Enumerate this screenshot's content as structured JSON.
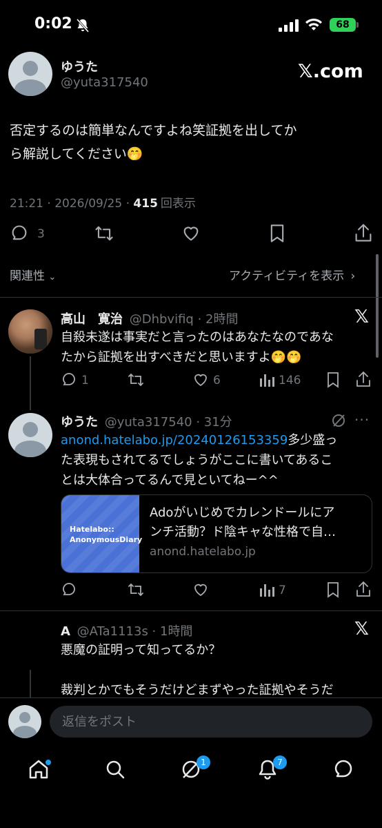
{
  "status_bar": {
    "time": "0:02",
    "battery": "68"
  },
  "main_tweet": {
    "display_name": "ゆうた",
    "handle": "@yuta317540",
    "brand": "𝕏.com",
    "text_line1": "否定するのは簡単なんですよね笑証拠を出してか",
    "text_line2": "ら解説してください🤭",
    "timestamp": "21:21 · 2026/09/25 · ",
    "views_count": "415",
    "views_label": "回表示",
    "reply_count": "3"
  },
  "filters": {
    "sort_label": "関連性",
    "activity_label": "アクティビティを表示"
  },
  "replies": [
    {
      "display_name": "高山　寛治",
      "handle": "@Dhbvifiq · 2時間",
      "text_line1": "自殺未遂は事実だと言ったのはあなたなのであな",
      "text_line2": "たから証拠を出すべきだと思いますよ🤭🤭",
      "reply_count": "1",
      "like_count": "6",
      "view_count": "146"
    },
    {
      "display_name": "ゆうた",
      "handle": "@yuta317540 · 31分",
      "link_text": "anond.hatelabo.jp/20240126153359",
      "text_line1_rest": "多少盛っ",
      "text_line2": "た表現もされてるでしょうがここに書いてあるこ",
      "text_line3": "とは大体合ってるんで見といてねー^^",
      "card_image_line1": "Hatelabo::",
      "card_image_line2": "AnonymousDiary",
      "card_title_line1": "Adoがいじめでカレンドールにア",
      "card_title_line2": "ンチ活動？ド陰キャな性格で自…",
      "card_domain": "anond.hatelabo.jp",
      "view_count": "7"
    },
    {
      "display_name": "A",
      "handle": "@ATa1113s · 1時間",
      "text_line1": "悪魔の証明って知ってるか？",
      "text_line2": "裁判とかでもそうだけどまずやった証拠やそうだ"
    }
  ],
  "reply_input": {
    "placeholder": "返信をポスト"
  },
  "bottom_nav": {
    "grok_badge": "1",
    "notifications_badge": "7"
  }
}
